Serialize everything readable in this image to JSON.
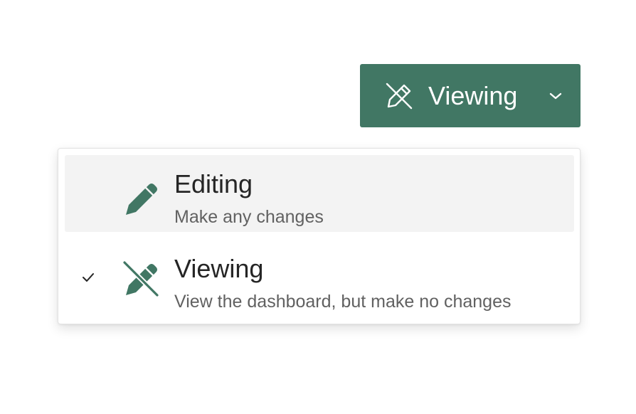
{
  "colors": {
    "accent": "#417764",
    "menu_hover_bg": "#f3f3f3",
    "title_text": "#252525",
    "description_text": "#616161"
  },
  "mode_button": {
    "label": "Viewing",
    "icon": "pencil-off-icon",
    "chevron": "chevron-down-icon"
  },
  "menu": {
    "items": [
      {
        "title": "Editing",
        "description": "Make any changes",
        "icon": "pencil-icon",
        "selected": false,
        "hovered": true
      },
      {
        "title": "Viewing",
        "description": "View the dashboard, but make no changes",
        "icon": "pencil-off-icon",
        "selected": true,
        "hovered": false
      }
    ]
  }
}
